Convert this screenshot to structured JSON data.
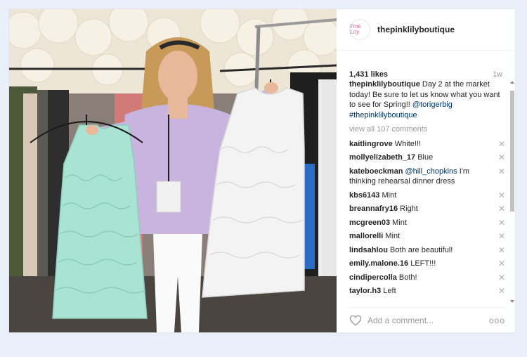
{
  "post": {
    "username": "thepinklilyboutique",
    "avatar_text": "Pink Lily",
    "likes": "1,431 likes",
    "time": "1w",
    "caption": {
      "user": "thepinklilyboutique",
      "text": " Day 2 at the market today! Be sure to let us know what you want to see for Spring!! ",
      "mention": "@torigerbig",
      "hashtag": "#thepinklilyboutique"
    },
    "view_all": "view all 107 comments",
    "comments": [
      {
        "user": "kaitlingrove",
        "text": " White!!!"
      },
      {
        "user": "mollyelizabeth_17",
        "text": " Blue"
      },
      {
        "user": "kateboeckman",
        "mention": " @hill_chopkins",
        "text": " I'm thinking rehearsal dinner dress"
      },
      {
        "user": "kbs6143",
        "text": " Mint"
      },
      {
        "user": "breannafry16",
        "text": " Right"
      },
      {
        "user": "mcgreen03",
        "text": " Mint"
      },
      {
        "user": "mallorelli",
        "text": " Mint"
      },
      {
        "user": "lindsahlou",
        "text": " Both are beautiful!"
      },
      {
        "user": "emily.malone.16",
        "text": " LEFT!!!"
      },
      {
        "user": "cindipercolla",
        "text": " Both!"
      },
      {
        "user": "taylor.h3",
        "text": " Left"
      }
    ],
    "delete_glyph": "✕",
    "add_comment_placeholder": "Add a comment...",
    "more_glyph": "ooo"
  },
  "colors": {
    "mint_dress": "#a9e3d3",
    "white_dress": "#f3f3f3",
    "sweater": "#c9b4df",
    "link": "#003569"
  },
  "icons": {
    "heart": "heart-icon",
    "more": "more-options-icon",
    "delete": "close-icon"
  }
}
